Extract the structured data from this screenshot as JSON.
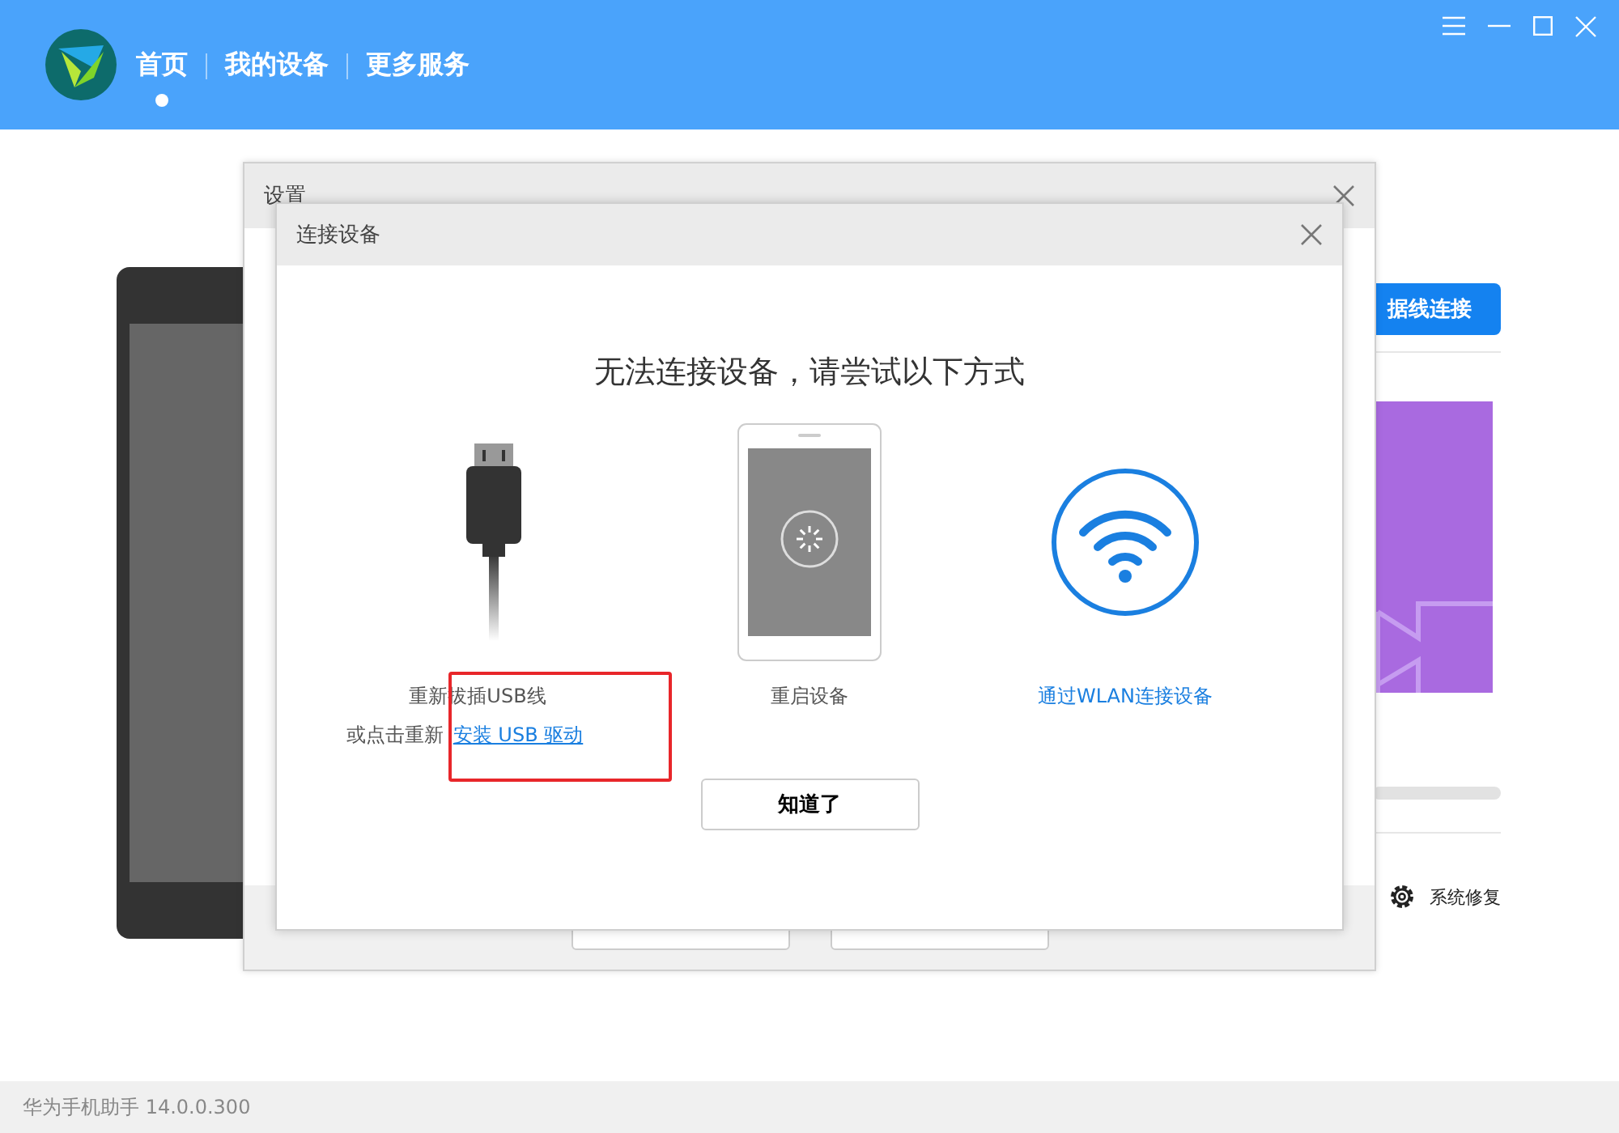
{
  "nav": [
    {
      "label": "首页",
      "selected": true
    },
    {
      "label": "我的设备",
      "selected": false
    },
    {
      "label": "更多服务",
      "selected": false
    }
  ],
  "home": {
    "connect_button": "据线连接",
    "repair_action": "系统修复"
  },
  "settings_dialog": {
    "title": "设置"
  },
  "connect_dialog": {
    "title": "连接设备",
    "heading": "无法连接设备，请尝试以下方式",
    "options": [
      {
        "kind": "usb",
        "label": "重新拔插USB线",
        "hint": "或点击重新",
        "link": "安装 USB 驱动"
      },
      {
        "kind": "restart",
        "label": "重启设备"
      },
      {
        "kind": "wlan",
        "label": "通过WLAN连接设备"
      }
    ],
    "confirm": "知道了"
  },
  "status_bar": {
    "text": "华为手机助手 14.0.0.300"
  }
}
